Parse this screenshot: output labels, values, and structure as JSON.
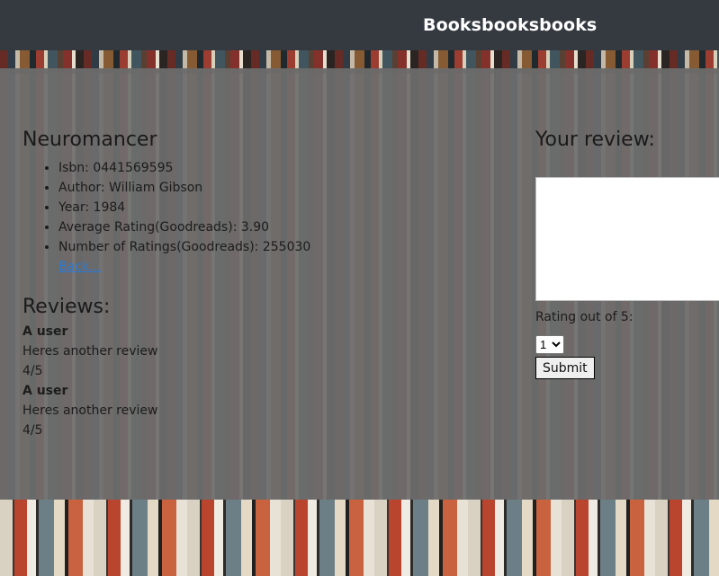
{
  "navbar": {
    "brand": "Booksbooksbooks"
  },
  "book": {
    "title": "Neuromancer",
    "details": [
      "Isbn: 0441569595",
      "Author: William Gibson",
      "Year: 1984",
      "Average Rating(Goodreads): 3.90",
      "Number of Ratings(Goodreads): 255030"
    ],
    "back_link": "Back..."
  },
  "reviews": {
    "heading": "Reviews:",
    "items": [
      {
        "user": "A user",
        "text": "Heres another review",
        "score": "4/5"
      },
      {
        "user": "A user",
        "text": "Heres another review",
        "score": "4/5"
      }
    ]
  },
  "review_form": {
    "heading": "Your review:",
    "rating_label": "Rating out of 5:",
    "rating_selected": "1",
    "submit_label": "Submit"
  },
  "colors": {
    "navbar": "#343a40",
    "link": "#2a7bd8"
  }
}
